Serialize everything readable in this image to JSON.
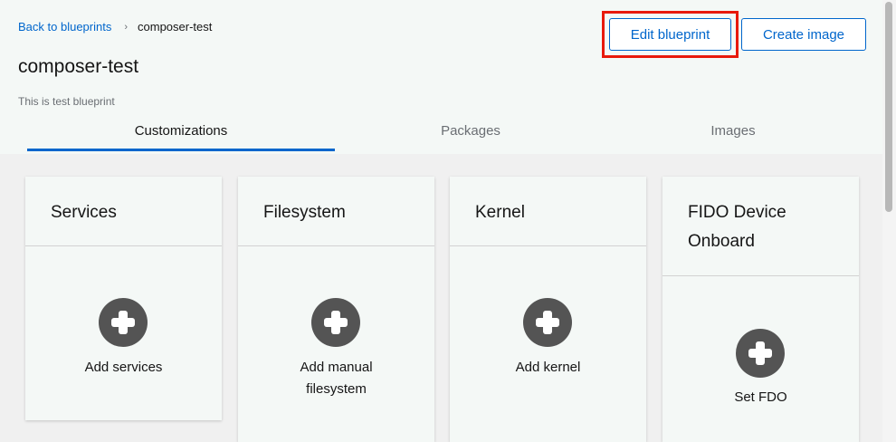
{
  "breadcrumb": {
    "back_label": "Back to blueprints",
    "separator": "›",
    "current": "composer-test"
  },
  "page": {
    "title": "composer-test",
    "description": "This is test blueprint"
  },
  "actions": {
    "edit_label": "Edit blueprint",
    "create_label": "Create image"
  },
  "tabs": [
    {
      "label": "Customizations",
      "active": true
    },
    {
      "label": "Packages",
      "active": false
    },
    {
      "label": "Images",
      "active": false
    }
  ],
  "cards": [
    {
      "title": "Services",
      "action": "Add services"
    },
    {
      "title": "Filesystem",
      "action": "Add manual filesystem"
    },
    {
      "title": "Kernel",
      "action": "Add kernel"
    },
    {
      "title": "FIDO Device Onboard",
      "action": "Set FDO"
    }
  ],
  "colors": {
    "accent": "#0066cc",
    "highlight": "#e8190b",
    "header_bg": "#f4f8f6",
    "content_bg": "#f0f0f0",
    "plus_icon": "#545454"
  },
  "icons": {
    "card_action": "plus-circle-icon",
    "breadcrumb_separator": "angle-right-icon"
  }
}
